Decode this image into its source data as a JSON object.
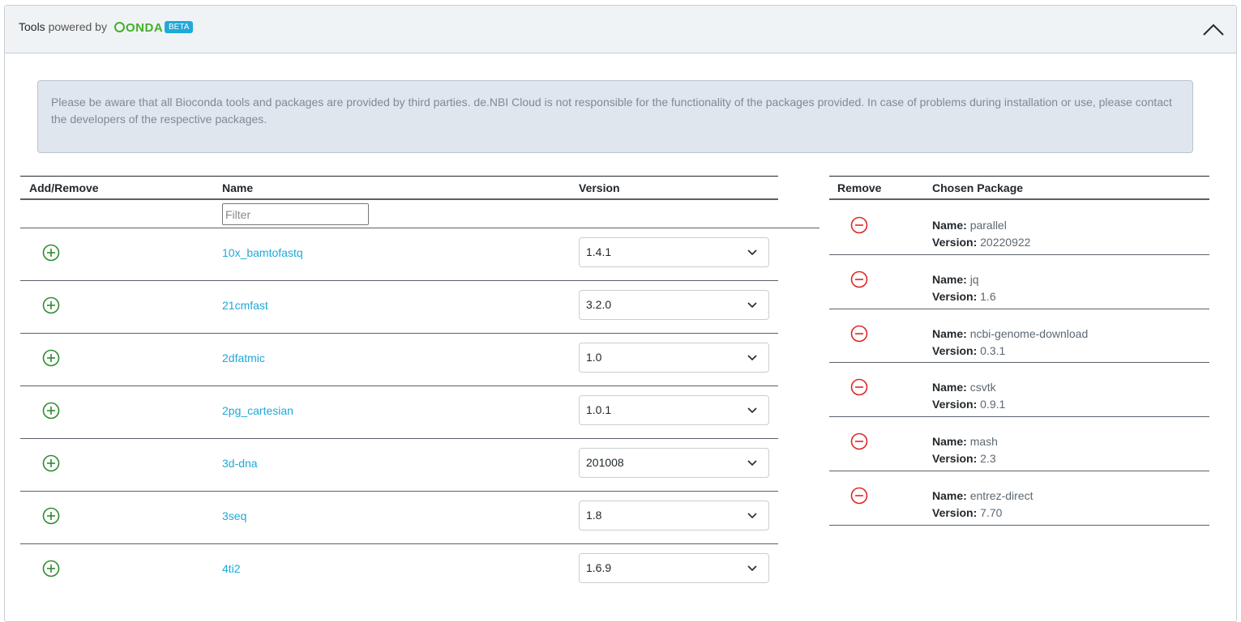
{
  "header": {
    "title": "Tools",
    "powered_by": "powered by",
    "logo_text": "ONDA",
    "badge": "BETA"
  },
  "alert": {
    "text": "Please be aware that all Bioconda tools and packages are provided by third parties. de.NBI Cloud is not responsible for the functionality of the packages provided. In case of problems during installation or use, please contact the developers of the respective packages."
  },
  "tools_table": {
    "columns": [
      "Add/Remove",
      "Name",
      "Version"
    ],
    "filter_placeholder": "Filter",
    "rows": [
      {
        "name": "10x_bamtofastq",
        "version": "1.4.1"
      },
      {
        "name": "21cmfast",
        "version": "3.2.0"
      },
      {
        "name": "2dfatmic",
        "version": "1.0"
      },
      {
        "name": "2pg_cartesian",
        "version": "1.0.1"
      },
      {
        "name": "3d-dna",
        "version": "201008"
      },
      {
        "name": "3seq",
        "version": "1.8"
      },
      {
        "name": "4ti2",
        "version": "1.6.9"
      }
    ]
  },
  "chosen_table": {
    "columns": [
      "Remove",
      "Chosen Package"
    ],
    "name_label": "Name:",
    "version_label": "Version:",
    "rows": [
      {
        "name": "parallel",
        "version": "20220922"
      },
      {
        "name": "jq",
        "version": "1.6"
      },
      {
        "name": "ncbi-genome-download",
        "version": "0.3.1"
      },
      {
        "name": "csvtk",
        "version": "0.9.1"
      },
      {
        "name": "mash",
        "version": "2.3"
      },
      {
        "name": "entrez-direct",
        "version": "7.70"
      }
    ]
  },
  "colors": {
    "add_icon": "#2e8b2e",
    "remove_icon": "#e02424",
    "link": "#20a8d8",
    "conda_green": "#43b02a",
    "badge": "#20a8d8"
  },
  "icons": {
    "add": "plus-circle-icon",
    "remove": "minus-circle-icon",
    "collapse": "chevron-up-icon",
    "select": "chevron-down-icon"
  }
}
